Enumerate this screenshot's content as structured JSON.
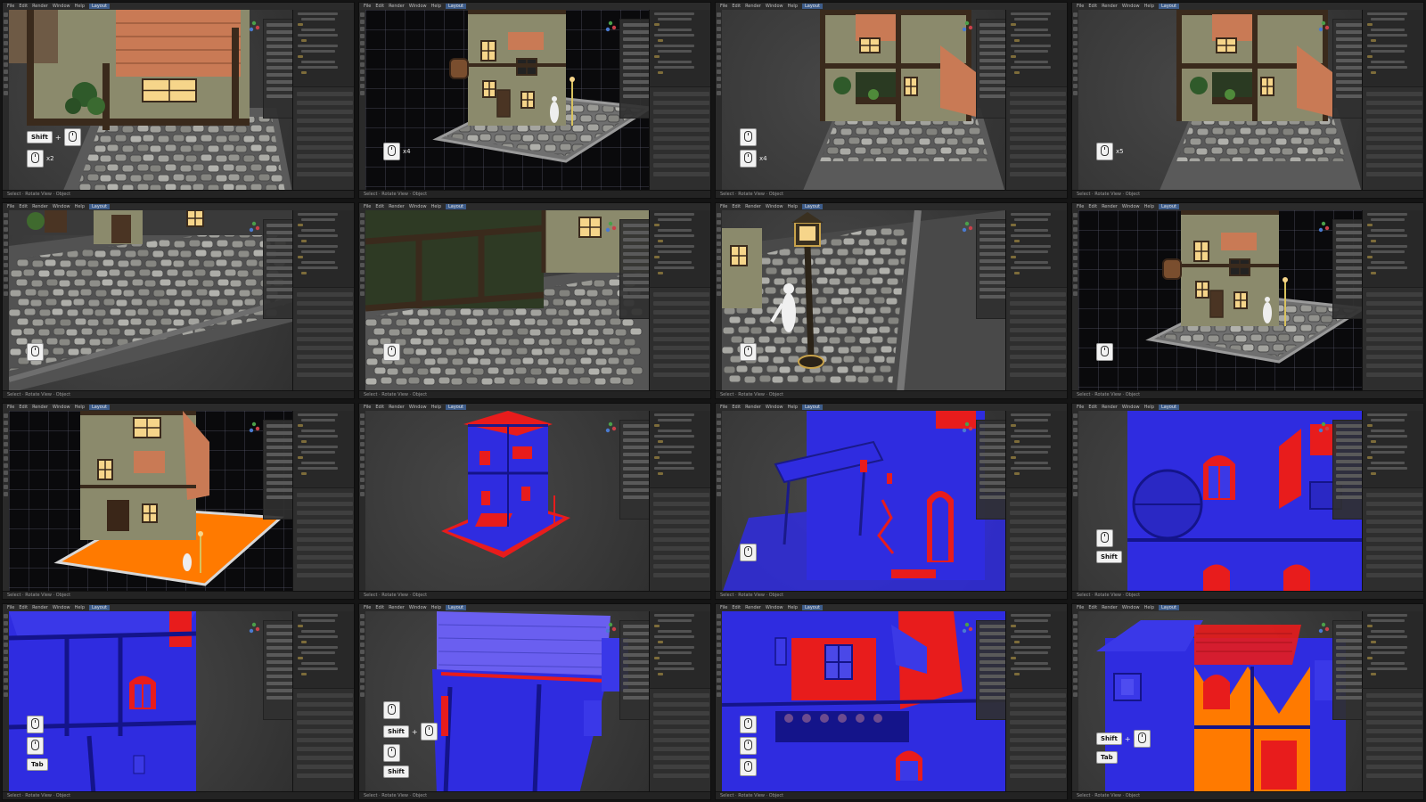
{
  "app": {
    "menu_items": [
      "File",
      "Edit",
      "Render",
      "Window",
      "Help"
    ],
    "workspace": "Layout",
    "status_text": "Select  ·  Rotate View  ·  Object"
  },
  "tiles": [
    {
      "id": 1,
      "background": "gray",
      "scene": "house-closeup-warm",
      "keys": [
        [
          "Shift",
          "+",
          "mouse"
        ],
        [
          "mouse",
          "x2"
        ]
      ]
    },
    {
      "id": 2,
      "background": "black",
      "scene": "house-full-warm",
      "keys": [
        [
          "mouse",
          "x4"
        ]
      ]
    },
    {
      "id": 3,
      "background": "gray",
      "scene": "house-front-balcony",
      "keys": [
        [
          "mouse"
        ],
        [
          "mouse",
          "x4"
        ]
      ]
    },
    {
      "id": 4,
      "background": "gray",
      "scene": "house-front-balcony",
      "keys": [
        [
          "mouse",
          "x5"
        ]
      ]
    },
    {
      "id": 5,
      "background": "gray",
      "scene": "cobblestone-closeup",
      "keys": [
        [
          "mouse"
        ]
      ]
    },
    {
      "id": 6,
      "background": "gray",
      "scene": "cobblestone-wall",
      "keys": [
        [
          "mouse"
        ]
      ]
    },
    {
      "id": 7,
      "background": "gray",
      "scene": "lamppost-closeup",
      "keys": [
        [
          "mouse"
        ]
      ]
    },
    {
      "id": 8,
      "background": "black",
      "scene": "house-full-warm",
      "keys": [
        [
          "mouse"
        ]
      ]
    },
    {
      "id": 9,
      "background": "black",
      "scene": "house-orange-base",
      "keys": []
    },
    {
      "id": 10,
      "background": "gray",
      "scene": "house-blue-red-full",
      "keys": []
    },
    {
      "id": 11,
      "background": "gray",
      "scene": "blue-red-porch",
      "keys": [
        [
          "mouse"
        ]
      ]
    },
    {
      "id": 12,
      "background": "gray",
      "scene": "blue-red-windows",
      "keys": [
        [
          "mouse"
        ],
        [
          "Shift"
        ]
      ]
    },
    {
      "id": 13,
      "background": "gray",
      "scene": "blue-red-side-wall",
      "keys": [
        [
          "mouse"
        ],
        [
          "mouse"
        ],
        [
          "Tab"
        ]
      ]
    },
    {
      "id": 14,
      "background": "gray",
      "scene": "blue-red-roof",
      "keys": [
        [
          "mouse"
        ],
        [
          "Shift",
          "+",
          "mouse"
        ],
        [
          "mouse"
        ],
        [
          "Shift"
        ]
      ]
    },
    {
      "id": 15,
      "background": "gray",
      "scene": "blue-red-balcony",
      "keys": [
        [
          "mouse"
        ],
        [
          "mouse"
        ],
        [
          "mouse"
        ]
      ]
    },
    {
      "id": 16,
      "background": "gray",
      "scene": "blue-orange-facade",
      "keys": [
        [
          "Shift",
          "+",
          "mouse"
        ],
        [
          "Tab"
        ]
      ]
    }
  ],
  "colors": {
    "face_blue": "#2f2ce0",
    "face_red": "#e81c1c",
    "orange_select": "#ff7a00",
    "wall_cream": "#8b8a6c",
    "timber_dark": "#3a2a1c",
    "roof_terracotta": "#c97a55",
    "window_glow": "#f6d58a",
    "stone": "#8a8a8a"
  }
}
